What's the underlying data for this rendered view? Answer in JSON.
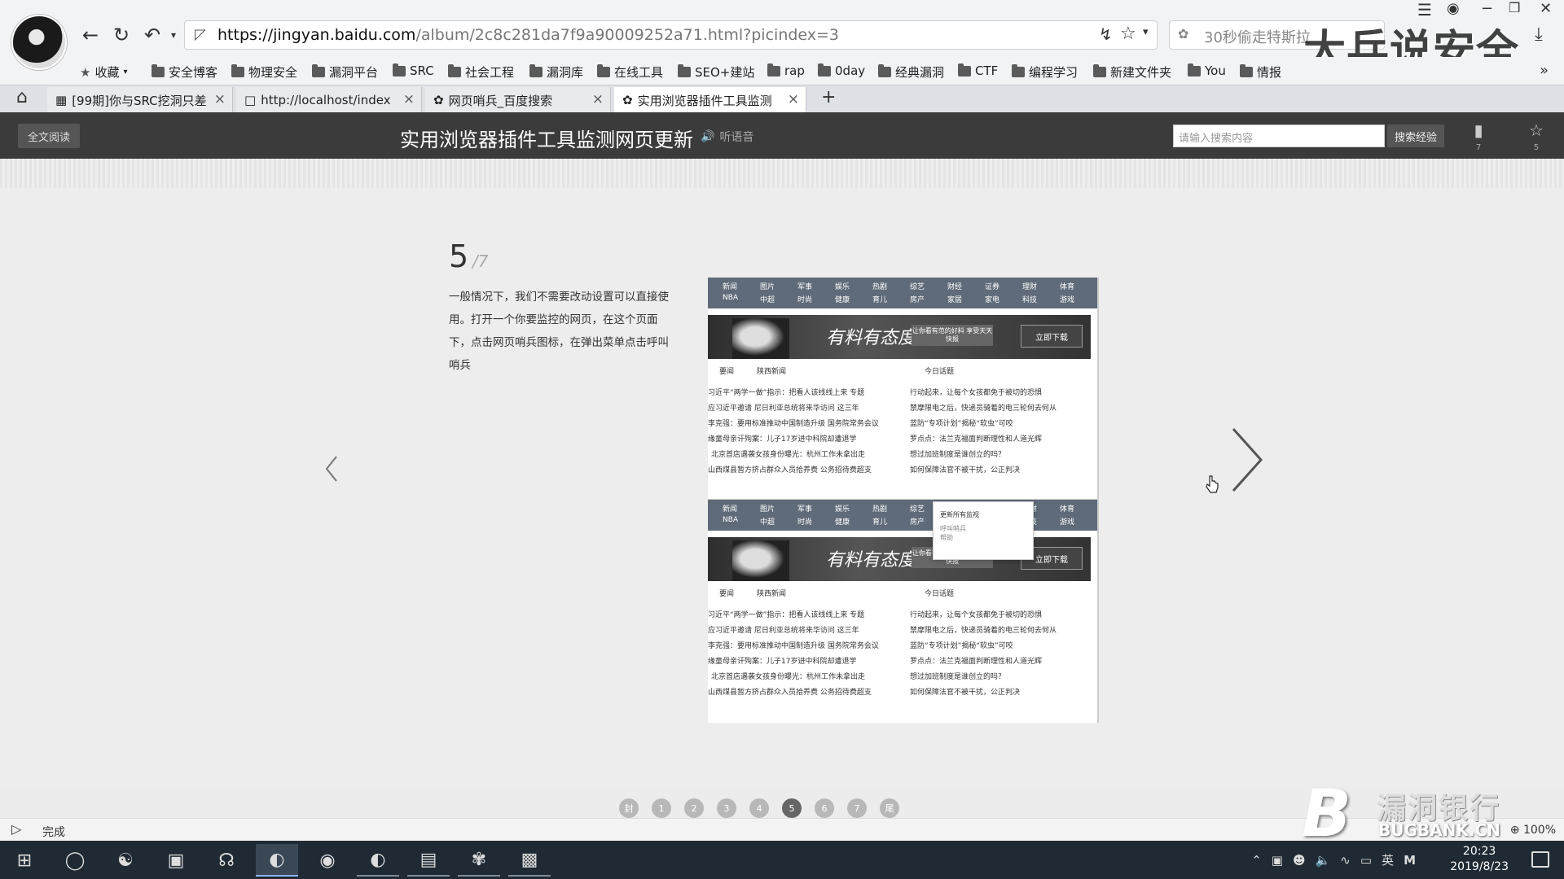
{
  "browser": {
    "url_prefix": "https://jingyan.baidu.com",
    "url_rest": "/album/2c8c281da7f9a90009252a71.html?picindex=3",
    "search_text": "30秒偷走特斯拉",
    "watermark": "大兵说安全"
  },
  "bookmarks": [
    {
      "label": "收藏",
      "type": "star"
    },
    {
      "label": "安全博客",
      "type": "folder"
    },
    {
      "label": "物理安全",
      "type": "folder"
    },
    {
      "label": "漏洞平台",
      "type": "folder"
    },
    {
      "label": "SRC",
      "type": "folder"
    },
    {
      "label": "社会工程",
      "type": "folder"
    },
    {
      "label": "漏洞库",
      "type": "folder"
    },
    {
      "label": "在线工具",
      "type": "folder"
    },
    {
      "label": "SEO+建站",
      "type": "folder"
    },
    {
      "label": "rap",
      "type": "folder"
    },
    {
      "label": "0day",
      "type": "folder"
    },
    {
      "label": "经典漏洞",
      "type": "folder"
    },
    {
      "label": "CTF",
      "type": "folder"
    },
    {
      "label": "编程学习",
      "type": "folder"
    },
    {
      "label": "新建文件夹",
      "type": "folder"
    },
    {
      "label": "You",
      "type": "folder"
    },
    {
      "label": "情报",
      "type": "folder"
    }
  ],
  "tabs": [
    {
      "label": "[99期]你与SRC挖洞只差"
    },
    {
      "label": "http://localhost/index"
    },
    {
      "label": "网页哨兵_百度搜索"
    },
    {
      "label": "实用浏览器插件工具监测"
    }
  ],
  "header": {
    "fullread": "全文阅读",
    "title": "实用浏览器插件工具监测网页更新",
    "listen": "听语音",
    "search_placeholder": "请输入搜索内容",
    "search_btn": "搜索经验",
    "icon_counts": [
      "7",
      "5"
    ]
  },
  "step": {
    "num": "5",
    "total": "/7",
    "text": "一般情况下，我们不需要改动设置可以直接使用。打开一个你要监控的网页，在这个页面下，点击网页哨兵图标，在弹出菜单点击呼叫哨兵"
  },
  "shot": {
    "nav_items": [
      "新闻",
      "图片",
      "军事",
      "娱乐",
      "热剧",
      "综艺",
      "财经",
      "证券",
      "理财",
      "体育",
      "NBA",
      "中超",
      "时尚",
      "健康",
      "育儿",
      "房产",
      "家居",
      "家电",
      "科技",
      "游戏"
    ],
    "banner_logo": "有料有态度",
    "banner_cta": "让你看有范的好料 享受天天快报",
    "banner_btn": "立即下载",
    "news_tabs": [
      "要闻",
      "陕西新闻",
      "今日话题"
    ],
    "news_left": [
      "习近平“两学一做”指示：把看人该线线上来 专题",
      "应习近平邀请 尼日利亚总统将来华访问 这三年",
      "李克强：要用标准推动中国制造升级 国务院常务会议",
      "缘童母亲讦殉案：儿子17岁进中科院却遭退学",
      "北京首店遇袭女孩身份曝光：杭州工作未拿出走",
      "山西煤县暂方挤占群众入员拾养费 公务招待费超支"
    ],
    "news_right": [
      "行动起来，让每个女孩都免于被切的恐惧",
      "禁摩限电之后，快递员骑着的电三轮何去何从",
      "蓝防“专项计划”揭秘“软虫”可咬",
      "罗点点：法兰克福面判断理性和人道光辉",
      "想过加班制度是谁创立的吗？",
      "如何保障法官不被干扰，公正判决"
    ],
    "popup_title": "更新所有监视",
    "popup_items": [
      "呼叫哨兵",
      "帮助"
    ]
  },
  "pager": [
    "封",
    "1",
    "2",
    "3",
    "4",
    "5",
    "6",
    "7",
    "尾"
  ],
  "pager_active": 5,
  "status": {
    "text": "完成",
    "zoom": "100%"
  },
  "bugbank": {
    "big": "漏洞银行",
    "small": "BUGBANK.CN"
  },
  "taskbar": {
    "time": "20:23",
    "date": "2019/8/23",
    "ime": "英"
  }
}
